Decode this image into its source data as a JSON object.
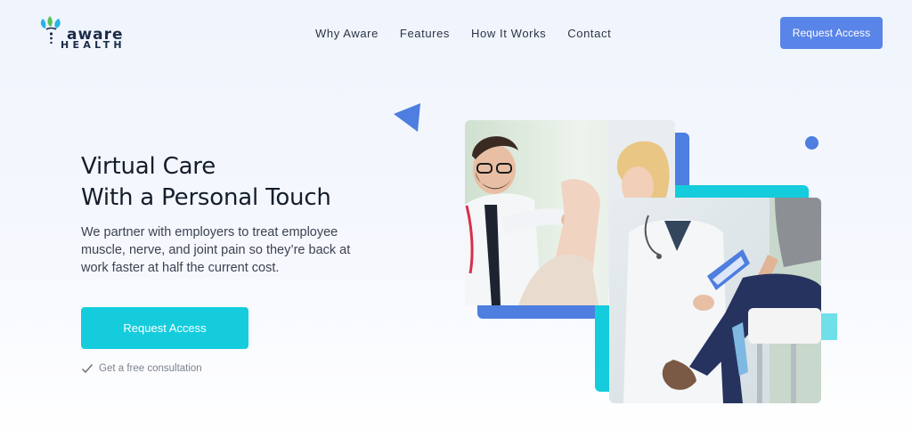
{
  "header": {
    "logo": {
      "word_top": "aware",
      "word_bottom": "HEALTH"
    },
    "nav": [
      {
        "label": "Why Aware"
      },
      {
        "label": "Features"
      },
      {
        "label": "How It Works"
      },
      {
        "label": "Contact"
      }
    ],
    "cta_label": "Request Access"
  },
  "hero": {
    "title_line1": "Virtual Care",
    "title_line2": "With a Personal Touch",
    "description": "We partner with employers to treat employee muscle, nerve, and joint pain so they’re back at work faster at half the current cost.",
    "cta_label": "Request Access",
    "note": "Get a free consultation"
  },
  "colors": {
    "primary_blue": "#5a85e8",
    "accent_cyan": "#15ccdd",
    "heading": "#141e2b",
    "logo_navy": "#1b2b48"
  },
  "icons": [
    "logo-leaf-icon",
    "check-icon",
    "triangle-decoration",
    "dot-decoration"
  ]
}
